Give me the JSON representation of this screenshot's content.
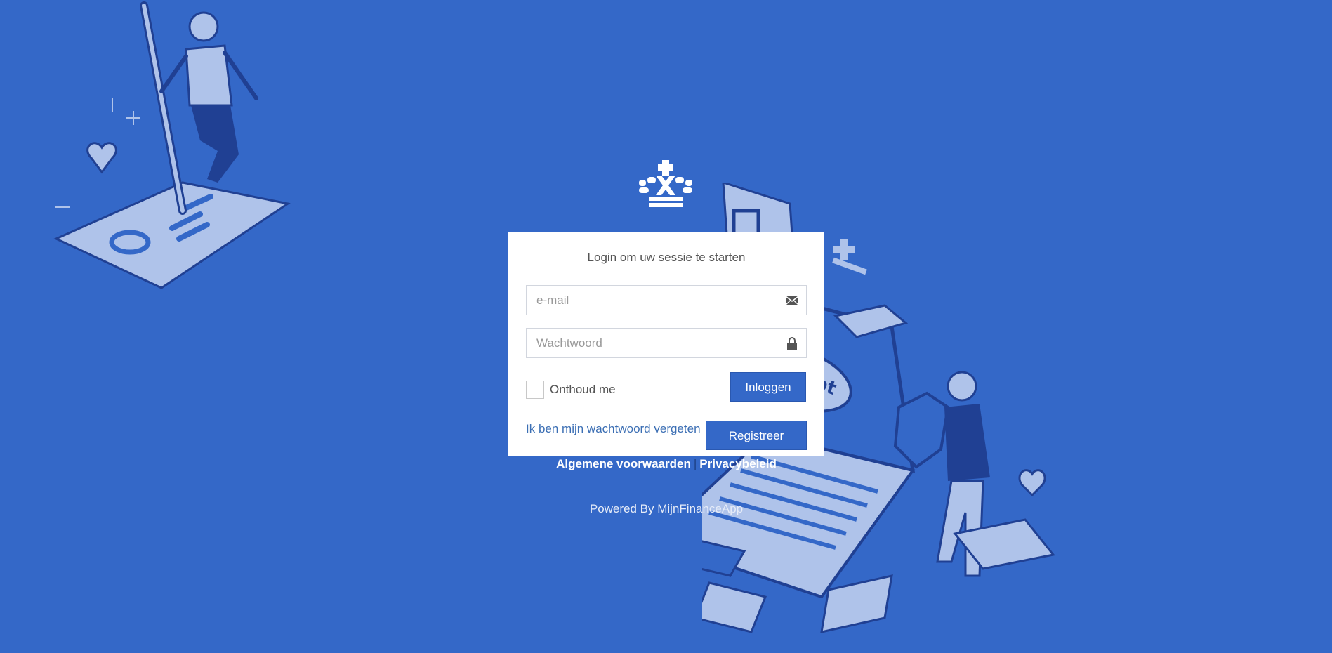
{
  "login": {
    "title": "Login om uw sessie te starten",
    "email_placeholder": "e-mail",
    "email_icon": "envelope-icon",
    "password_placeholder": "Wachtwoord",
    "password_icon": "lock-icon",
    "remember_label": "Onthoud me",
    "login_button": "Inloggen",
    "forgot_link": "Ik ben mijn wachtwoord vergeten",
    "register_button": "Registreer"
  },
  "footer": {
    "terms_link": "Algemene voorwaarden",
    "separator": "|",
    "privacy_link": "Privacybeleid",
    "powered_by": "Powered By MijnFinanceApp"
  },
  "colors": {
    "background": "#3468c8",
    "button": "#3468c8",
    "link": "#3c6fb4",
    "card": "#ffffff"
  }
}
